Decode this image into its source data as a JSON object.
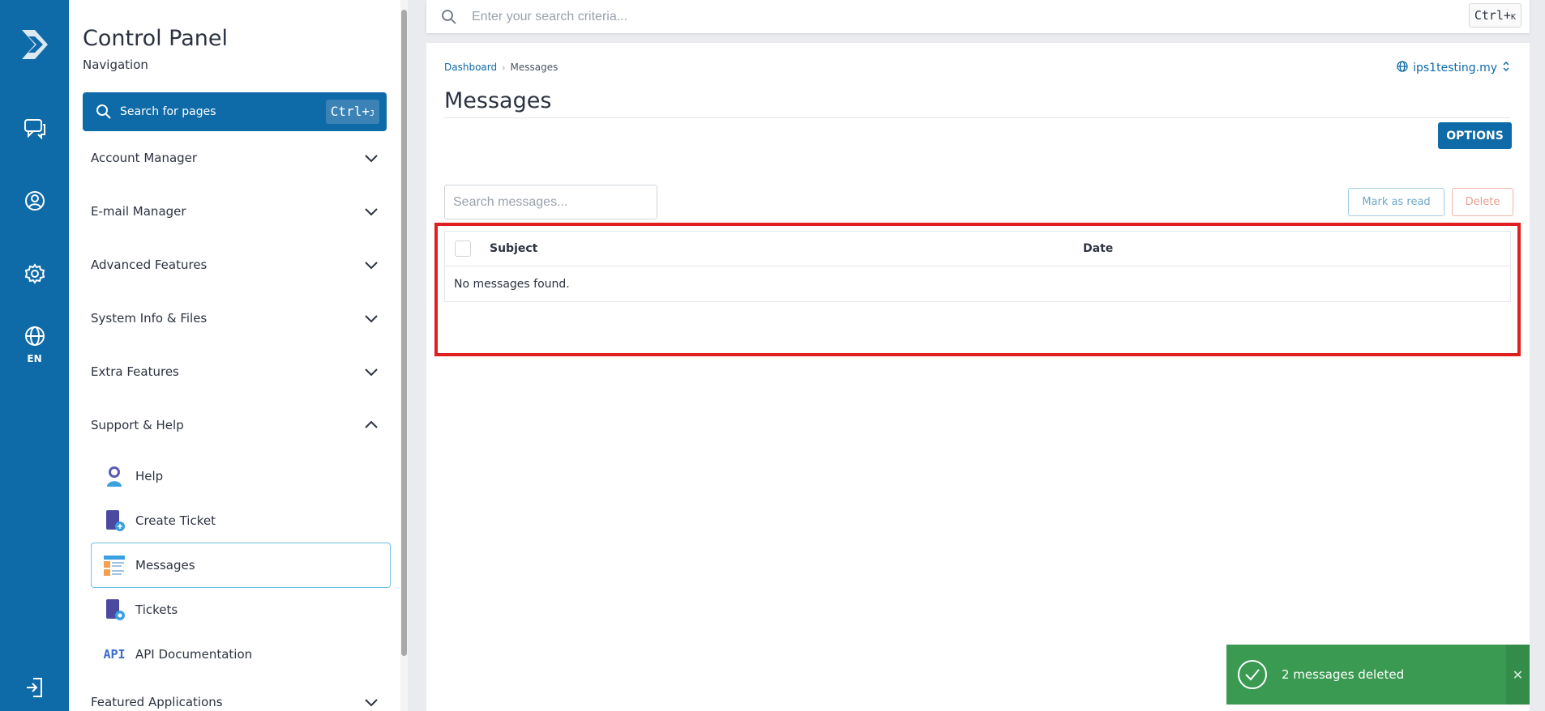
{
  "colors": {
    "brand_blue": "#0f6aa8",
    "toast_green": "#3a9a52",
    "highlight_red": "#e02020"
  },
  "rail": {
    "logo_icon": "chevron-logo-icon",
    "items": [
      {
        "icon": "chat-icon"
      },
      {
        "icon": "user-circle-icon"
      },
      {
        "icon": "gear-icon"
      },
      {
        "icon": "globe-icon",
        "label": "EN"
      },
      {
        "icon": "logout-icon"
      }
    ]
  },
  "nav": {
    "title": "Control Panel",
    "subtitle": "Navigation",
    "search": {
      "label": "Search for pages",
      "shortcut_main": "Ctrl+",
      "shortcut_key": "J"
    },
    "sections": [
      {
        "label": "Account Manager",
        "expanded": false
      },
      {
        "label": "E-mail Manager",
        "expanded": false
      },
      {
        "label": "Advanced Features",
        "expanded": false
      },
      {
        "label": "System Info & Files",
        "expanded": false
      },
      {
        "label": "Extra Features",
        "expanded": false
      },
      {
        "label": "Support & Help",
        "expanded": true
      },
      {
        "label": "Featured Applications",
        "expanded": false
      }
    ],
    "support_items": [
      {
        "label": "Help",
        "icon": "help-agent-icon"
      },
      {
        "label": "Create Ticket",
        "icon": "ticket-add-icon"
      },
      {
        "label": "Messages",
        "icon": "messages-icon",
        "active": true
      },
      {
        "label": "Tickets",
        "icon": "ticket-icon"
      },
      {
        "label": "API Documentation",
        "icon": "api-icon",
        "icon_text": "API"
      }
    ]
  },
  "topsearch": {
    "placeholder": "Enter your search criteria...",
    "shortcut_main": "Ctrl+",
    "shortcut_key": "K"
  },
  "main": {
    "breadcrumb": {
      "home": "Dashboard",
      "separator": "›",
      "current": "Messages"
    },
    "domain": "ips1testing.my",
    "title": "Messages",
    "options_label": "OPTIONS",
    "search_placeholder": "Search messages...",
    "mark_read_label": "Mark as read",
    "delete_label": "Delete",
    "table": {
      "columns": [
        "Subject",
        "Date"
      ],
      "empty_text": "No messages found."
    }
  },
  "toast": {
    "message": "2 messages deleted",
    "close_symbol": "✕"
  }
}
